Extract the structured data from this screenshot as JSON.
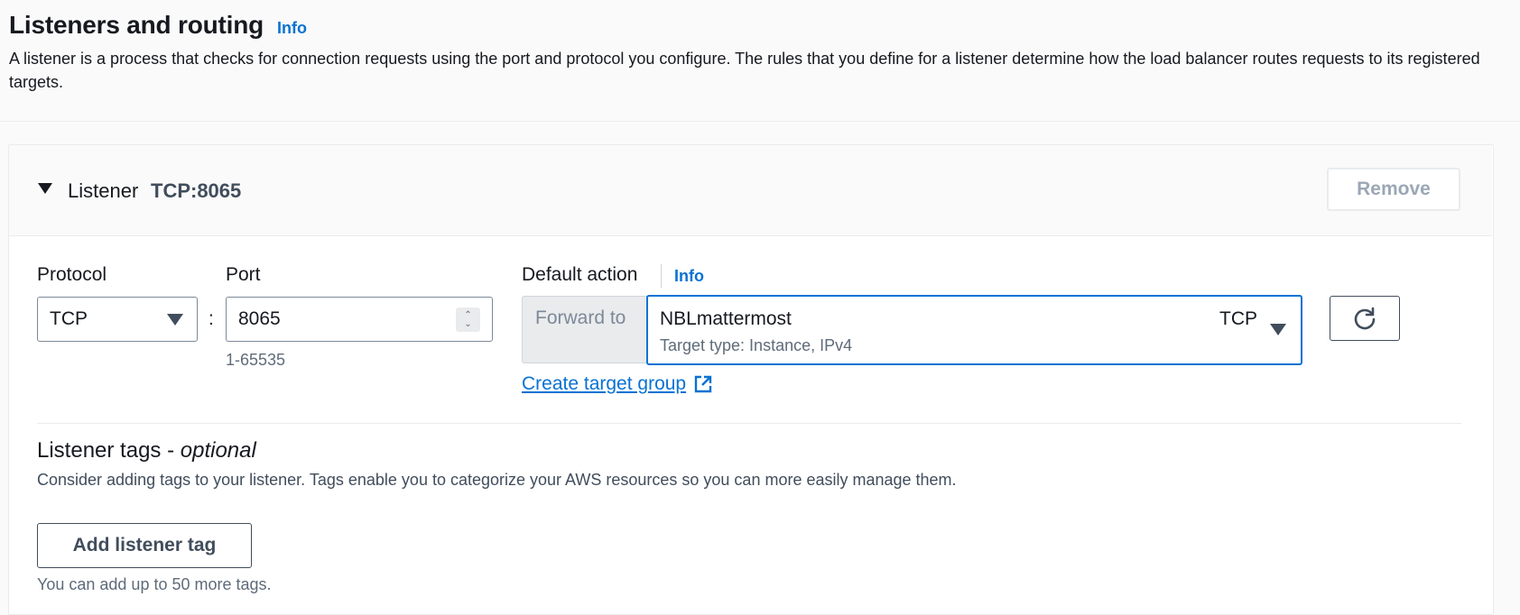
{
  "header": {
    "title": "Listeners and routing",
    "info_label": "Info",
    "description": "A listener is a process that checks for connection requests using the port and protocol you configure. The rules that you define for a listener determine how the load balancer routes requests to its registered targets."
  },
  "listener": {
    "label": "Listener",
    "name": "TCP:8065",
    "remove_label": "Remove",
    "protocol": {
      "label": "Protocol",
      "value": "TCP"
    },
    "separator": ":",
    "port": {
      "label": "Port",
      "value": "8065",
      "hint": "1-65535"
    },
    "default_action": {
      "label": "Default action",
      "info_label": "Info",
      "forward_label": "Forward to",
      "target_name": "NBLmattermost",
      "target_protocol": "TCP",
      "target_type": "Target type: Instance, IPv4",
      "create_link": "Create target group"
    },
    "tags": {
      "title": "Listener tags - ",
      "title_optional": "optional",
      "description": "Consider adding tags to your listener. Tags enable you to categorize your AWS resources so you can more easily manage them.",
      "add_label": "Add listener tag",
      "hint": "You can add up to 50 more tags."
    }
  },
  "colors": {
    "accent": "#0972d3",
    "text": "#16191f",
    "muted": "#5f6b7a"
  },
  "icons": [
    "caret-down-icon",
    "dropdown-caret-icon",
    "stepper-icon",
    "refresh-icon",
    "external-link-icon"
  ]
}
